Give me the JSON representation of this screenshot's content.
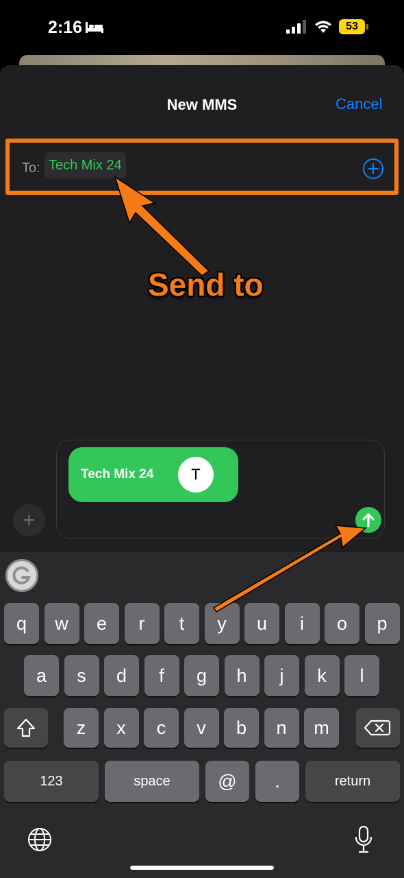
{
  "status_bar": {
    "time": "2:16",
    "battery": "53",
    "icons": [
      "bed-icon",
      "signal-icon",
      "wifi-icon",
      "battery-icon"
    ]
  },
  "header": {
    "title": "New MMS",
    "cancel_label": "Cancel"
  },
  "to_field": {
    "label": "To:",
    "recipient": "Tech Mix 24",
    "add_icon": "plus-circle-icon"
  },
  "annotation": {
    "label": "Send to",
    "color": "#f47b16"
  },
  "compose": {
    "contact_name": "Tech Mix 24",
    "avatar_initial": "T",
    "send_icon": "arrow-up-icon",
    "attach_icon": "plus-icon"
  },
  "keyboard": {
    "row1": [
      "q",
      "w",
      "e",
      "r",
      "t",
      "y",
      "u",
      "i",
      "o",
      "p"
    ],
    "row2": [
      "a",
      "s",
      "d",
      "f",
      "g",
      "h",
      "j",
      "k",
      "l"
    ],
    "row3": [
      "z",
      "x",
      "c",
      "v",
      "b",
      "n",
      "m"
    ],
    "numbers_label": "123",
    "space_label": "space",
    "at_label": "@",
    "period_label": ".",
    "return_label": "return",
    "icons": [
      "shift-icon",
      "backspace-icon",
      "globe-icon",
      "microphone-icon",
      "grammarly-icon"
    ]
  },
  "colors": {
    "accent_blue": "#0a84ff",
    "imessage_green": "#33c759",
    "annotation_orange": "#f47b16"
  }
}
